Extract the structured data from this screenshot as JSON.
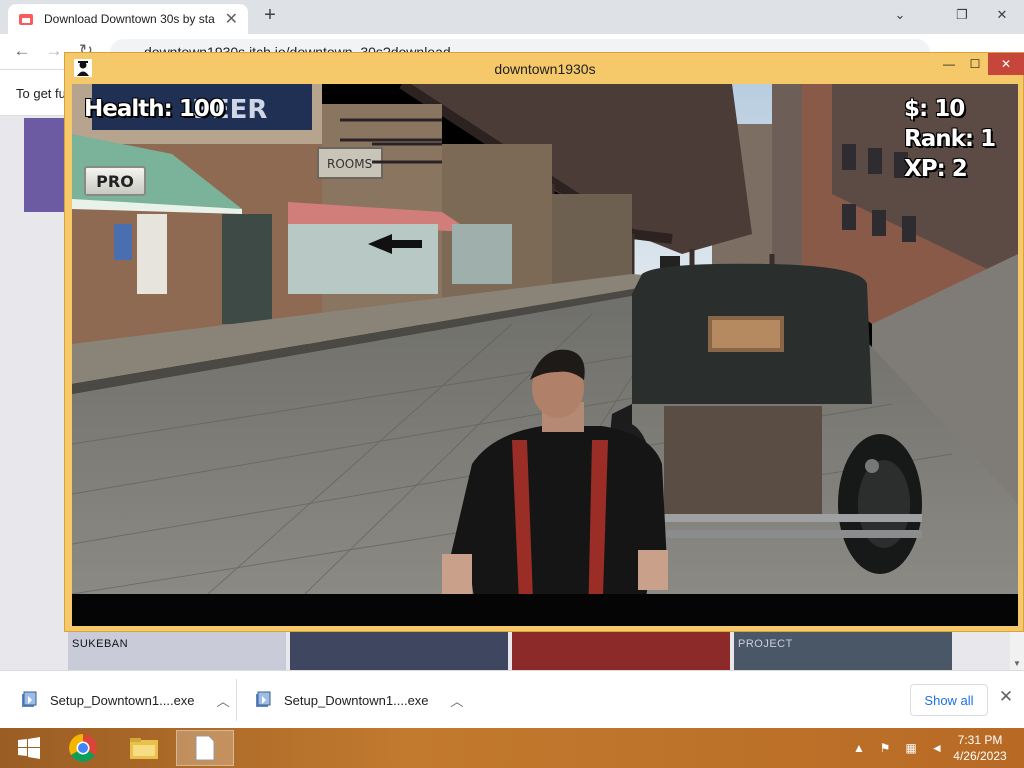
{
  "browser": {
    "tab_title": "Download Downtown 30s by sta",
    "url": "downtown1930s.itch.io/downtown_30s?download",
    "info_text": "To get fu",
    "thumb_label": "SUKEBAN",
    "thumb_label_2": "PROJECT"
  },
  "game": {
    "window_title": "downtown1930s",
    "hud": {
      "health": "Health: 100",
      "money": "$: 10",
      "rank": "Rank: 1",
      "xp": "XP: 2"
    },
    "pro_button": "PRO",
    "scene_signs": {
      "beer": "BEER",
      "rooms": "ROOMS"
    }
  },
  "downloads": {
    "items": [
      {
        "name": "Setup_Downtown1....exe"
      },
      {
        "name": "Setup_Downtown1....exe"
      }
    ],
    "show_all": "Show all"
  },
  "taskbar": {
    "time": "7:31 PM",
    "date": "4/26/2023"
  },
  "colors": {
    "game_frame": "#f5c96a",
    "close_red": "#c7463c",
    "taskbar": "#b86a25",
    "link_blue": "#1a73e8"
  }
}
